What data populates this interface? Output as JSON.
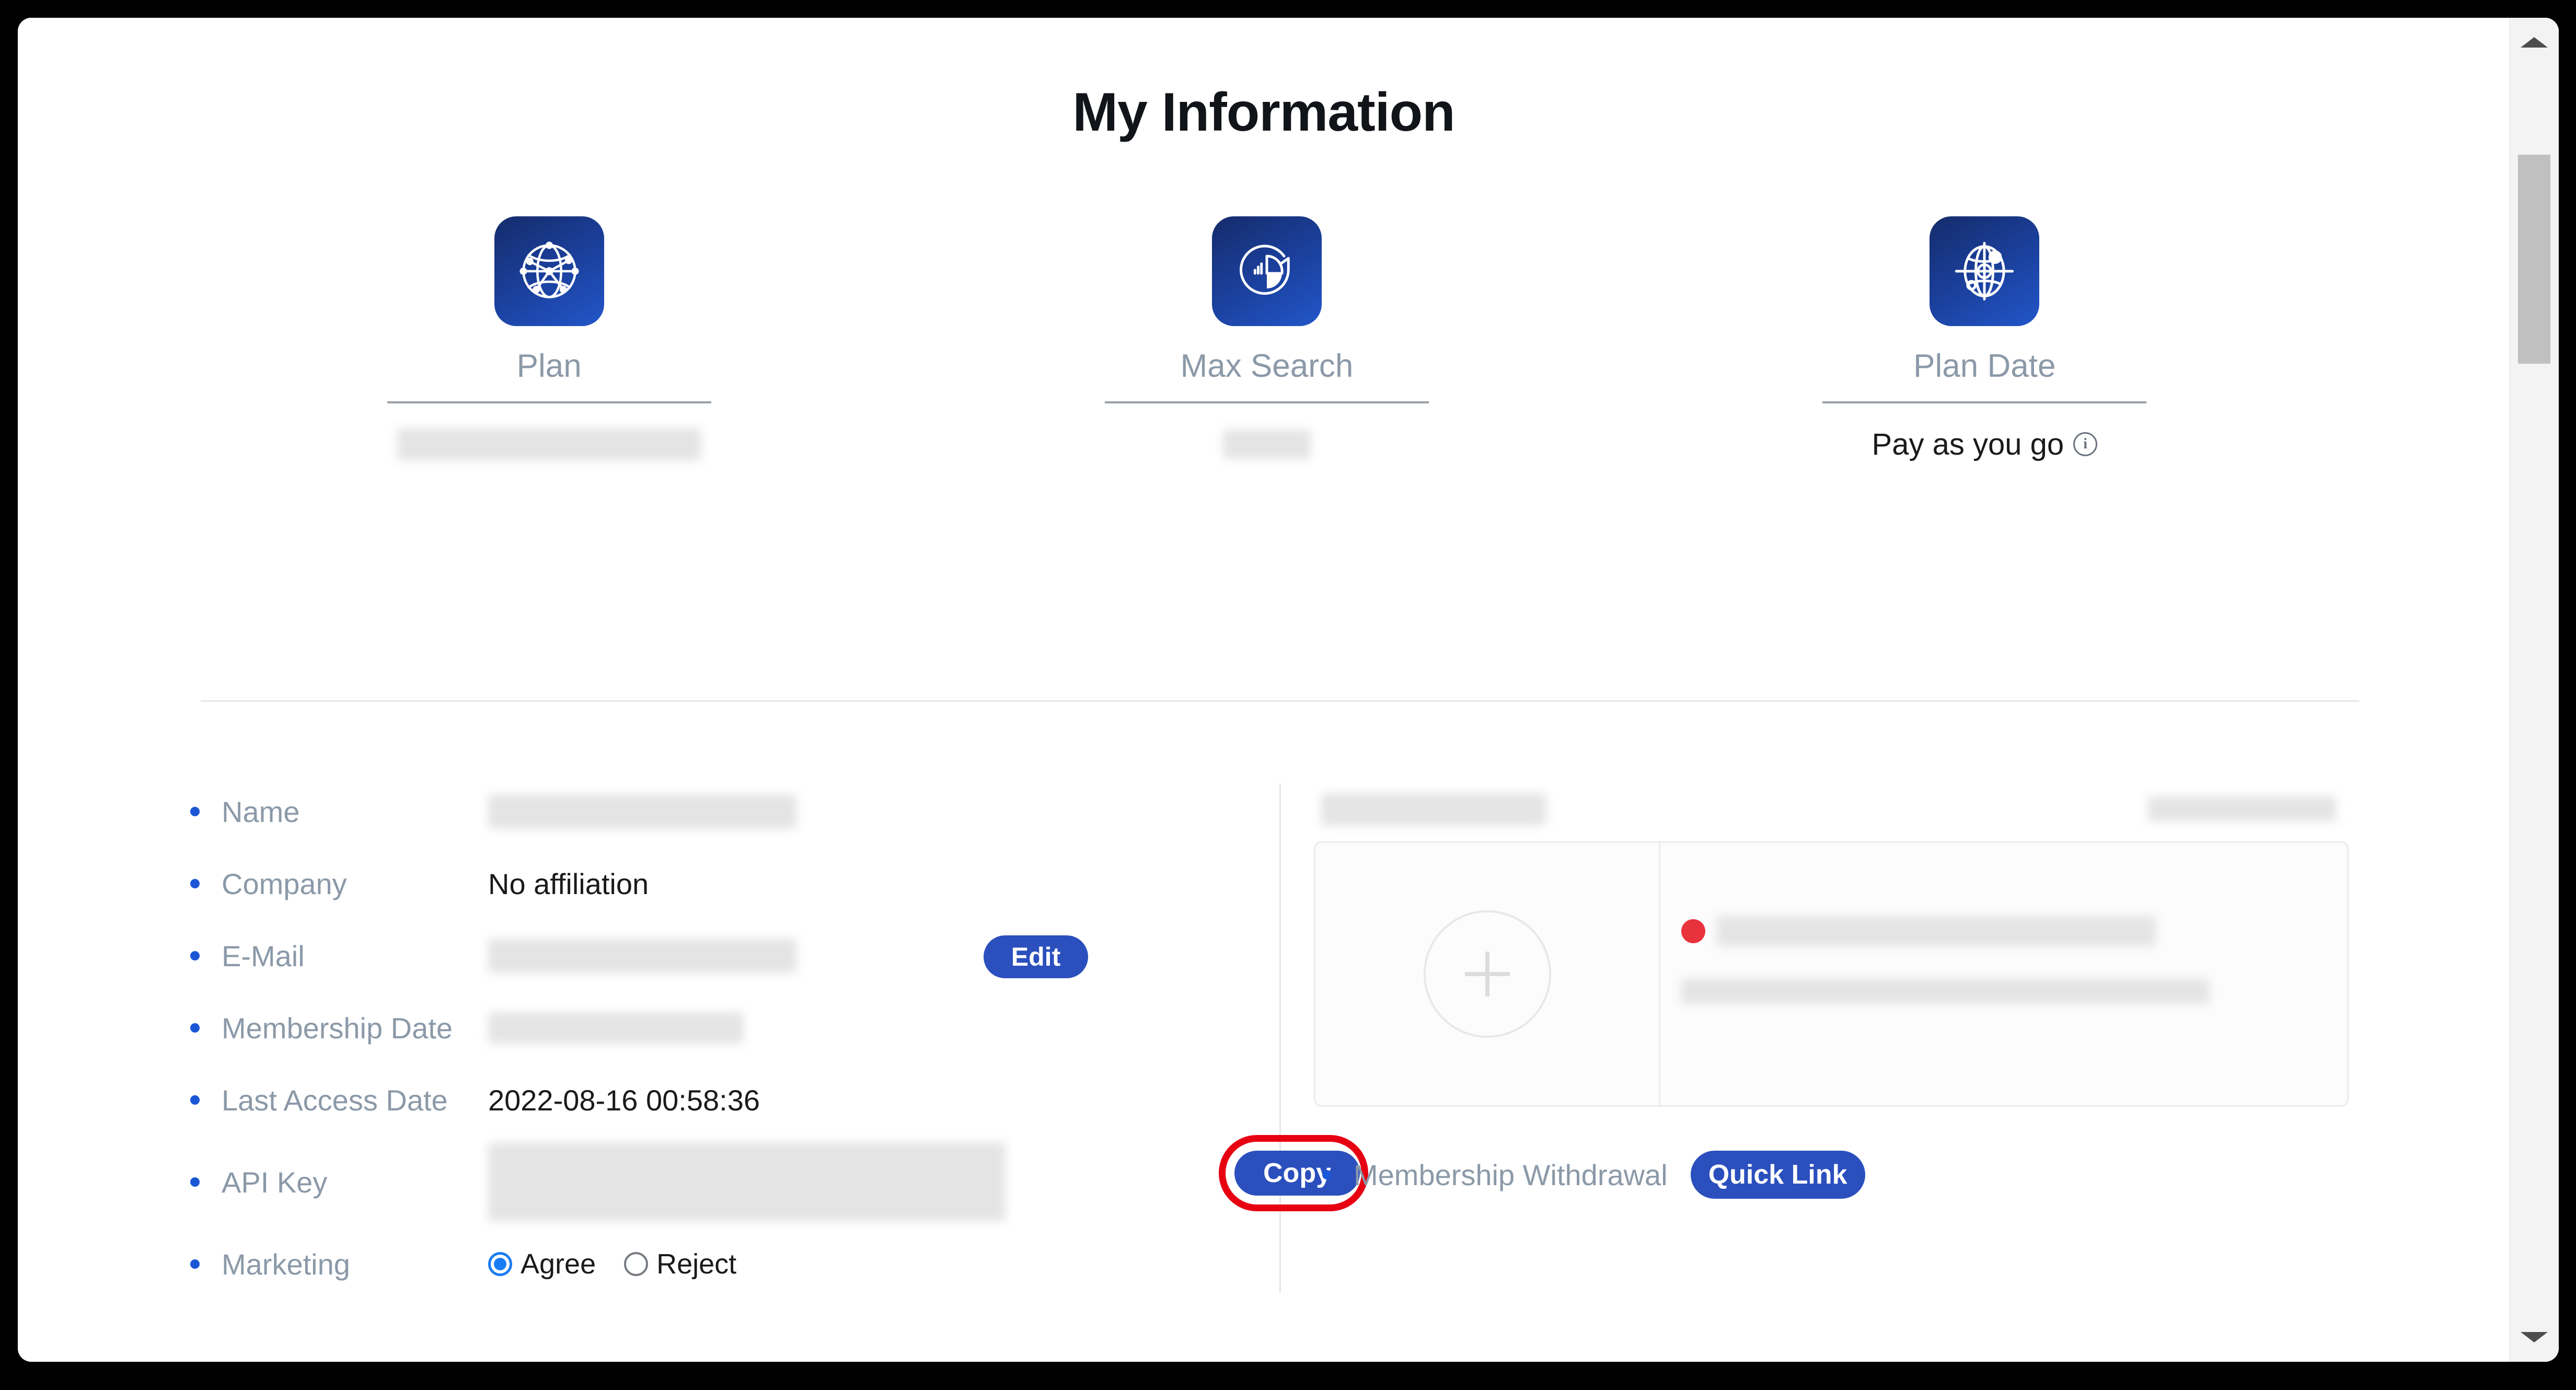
{
  "page": {
    "title": "My Information"
  },
  "stats": [
    {
      "icon": "network-globe-icon",
      "label": "Plan",
      "value": "",
      "value_redacted": true,
      "has_info": false
    },
    {
      "icon": "pie-chart-refresh-icon",
      "label": "Max Search",
      "value": "",
      "value_redacted": true,
      "has_info": false
    },
    {
      "icon": "globe-crosshair-icon",
      "label": "Plan Date",
      "value": "Pay as you go",
      "value_redacted": false,
      "has_info": true,
      "info_icon": "info-circle-icon"
    }
  ],
  "details": {
    "rows": [
      {
        "label": "Name",
        "value": "",
        "redacted": true
      },
      {
        "label": "Company",
        "value": "No affiliation",
        "redacted": false
      },
      {
        "label": "E-Mail",
        "value": "",
        "redacted": true
      },
      {
        "label": "Membership Date",
        "value": "",
        "redacted": true
      },
      {
        "label": "Last Access Date",
        "value": "2022-08-16 00:58:36",
        "redacted": false
      },
      {
        "label": "API Key",
        "value": "",
        "redacted": true
      },
      {
        "label": "Marketing",
        "value": "",
        "redacted": false
      }
    ],
    "edit_button": "Edit",
    "copy_button": "Copy",
    "marketing": {
      "agree_label": "Agree",
      "reject_label": "Reject",
      "selected": "Agree"
    }
  },
  "right_panel": {
    "withdrawal_label": "Membership Withdrawal",
    "quick_link_button": "Quick Link",
    "payment_card_redacted": true
  },
  "scrollbar": {
    "up_arrow": "scroll-up-arrow",
    "down_arrow": "scroll-down-arrow"
  },
  "colors": {
    "accent_blue": "#2b4fbd",
    "icon_gradient_start": "#152c6b",
    "icon_gradient_end": "#2256c9",
    "label_grey": "#8b99a8",
    "highlight_red": "#e60012",
    "radio_blue": "#1a7cf5",
    "warning_red": "#e8323c"
  }
}
